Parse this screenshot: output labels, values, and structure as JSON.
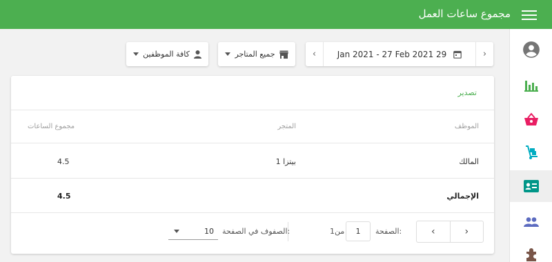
{
  "header": {
    "title": "مجموع ساعات العمل",
    "bar_color": "#4caf50"
  },
  "sidebar": {
    "items": [
      {
        "icon": "account-circle-icon",
        "color": "#757575"
      },
      {
        "icon": "bar-chart-icon",
        "color": "#4caf50"
      },
      {
        "icon": "shopping-basket-icon",
        "color": "#e91e63"
      },
      {
        "icon": "dolly-icon",
        "color": "#00acc1"
      },
      {
        "icon": "id-card-icon",
        "color": "#009688",
        "active": true
      },
      {
        "icon": "people-icon",
        "color": "#5c6bc0"
      },
      {
        "icon": "puzzle-icon",
        "color": "#795548"
      }
    ]
  },
  "toolbar": {
    "date_range": "Jan 2021 - 27 Feb 2021 29",
    "stores_label": "جميع المتاجر",
    "employees_label": "كافة الموظفين"
  },
  "report": {
    "export_label": "تصدير",
    "columns": {
      "employee": "الموظف",
      "store": "المتجر",
      "total_hours": "مجموع الساعات"
    },
    "rows": [
      {
        "employee": "المالك",
        "store": "بيتزا 1",
        "total_hours": "4.5"
      }
    ],
    "total": {
      "label": "الإجمالي",
      "total_hours": "4.5"
    }
  },
  "pagination": {
    "page_label": "الصفحة:",
    "page_value": "1",
    "of_label": "1من",
    "rows_per_page_label": "الصفوف في الصفحة:",
    "rows_per_page_value": "10"
  }
}
